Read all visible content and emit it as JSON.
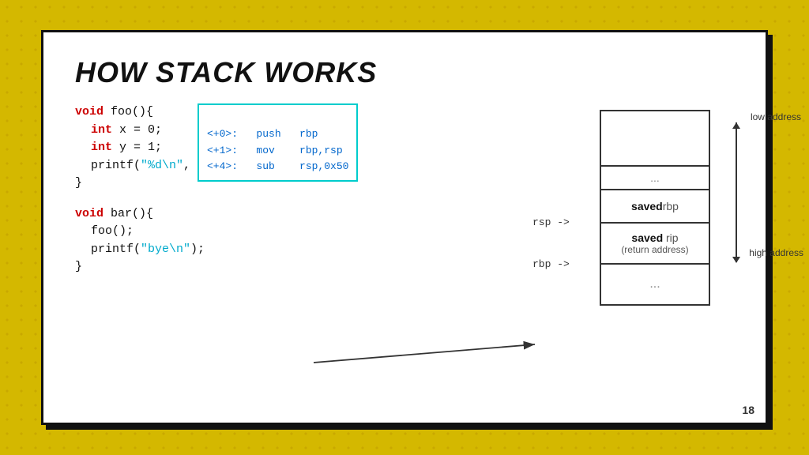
{
  "slide": {
    "title": "HOW STACK WORKS",
    "number": "18",
    "code": {
      "line1": "void foo(){",
      "line2_kw": "int",
      "line2_rest": " x = 0;",
      "line3_kw": "int",
      "line3_rest": " y = 1;",
      "line4a": "printf(",
      "line4_str": "\"%d\\n\"",
      "line4b": ", x + y);",
      "line5": "}",
      "line6": "",
      "line7": "void bar(){",
      "line8": "  foo();",
      "line9a": "  printf(",
      "line9_str": "\"bye\\n\"",
      "line9b": ");",
      "line10": "}"
    },
    "asm": {
      "line1_offset": "<+0>:",
      "line1_op": "push",
      "line1_arg": "rbp",
      "line2_offset": "<+1>:",
      "line2_op": "mov",
      "line2_arg": "rbp,rsp",
      "line3_offset": "<+4>:",
      "line3_op": "sub",
      "line3_arg": "rsp,0x50"
    },
    "stack": {
      "rsp_label": "rsp ->",
      "rbp_label": "rbp ->",
      "dots1": "...",
      "saved_rbp_bold": "saved",
      "saved_rbp_text": " rbp",
      "saved_rip_bold": "saved",
      "saved_rip_text": " rip",
      "return_address": "(return address)",
      "dots2": "..."
    },
    "addresses": {
      "low": "low address",
      "high": "high address"
    }
  }
}
